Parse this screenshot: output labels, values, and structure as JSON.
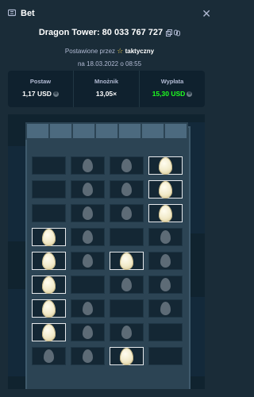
{
  "header": {
    "title": "Bet"
  },
  "bet": {
    "title": "Dragon Tower: 80 033 767 727",
    "placed_by_prefix": "Postawione przez",
    "placed_by_user": "taktyczny",
    "date": "na 18.03.2022 o 08:55"
  },
  "stats": {
    "stake_label": "Postaw",
    "stake_value": "1,17 USD",
    "multiplier_label": "Mnożnik",
    "multiplier_value": "13,05×",
    "payout_label": "Wypłata",
    "payout_value": "15,30 USD",
    "payout_color": "#1fff20"
  },
  "board": {
    "rows": [
      [
        0,
        1,
        1,
        2
      ],
      [
        0,
        1,
        1,
        2
      ],
      [
        0,
        1,
        1,
        2
      ],
      [
        2,
        1,
        0,
        1
      ],
      [
        2,
        1,
        2,
        1
      ],
      [
        2,
        0,
        1,
        1
      ],
      [
        2,
        1,
        0,
        1
      ],
      [
        2,
        1,
        1,
        0
      ],
      [
        1,
        1,
        2,
        0
      ]
    ]
  }
}
